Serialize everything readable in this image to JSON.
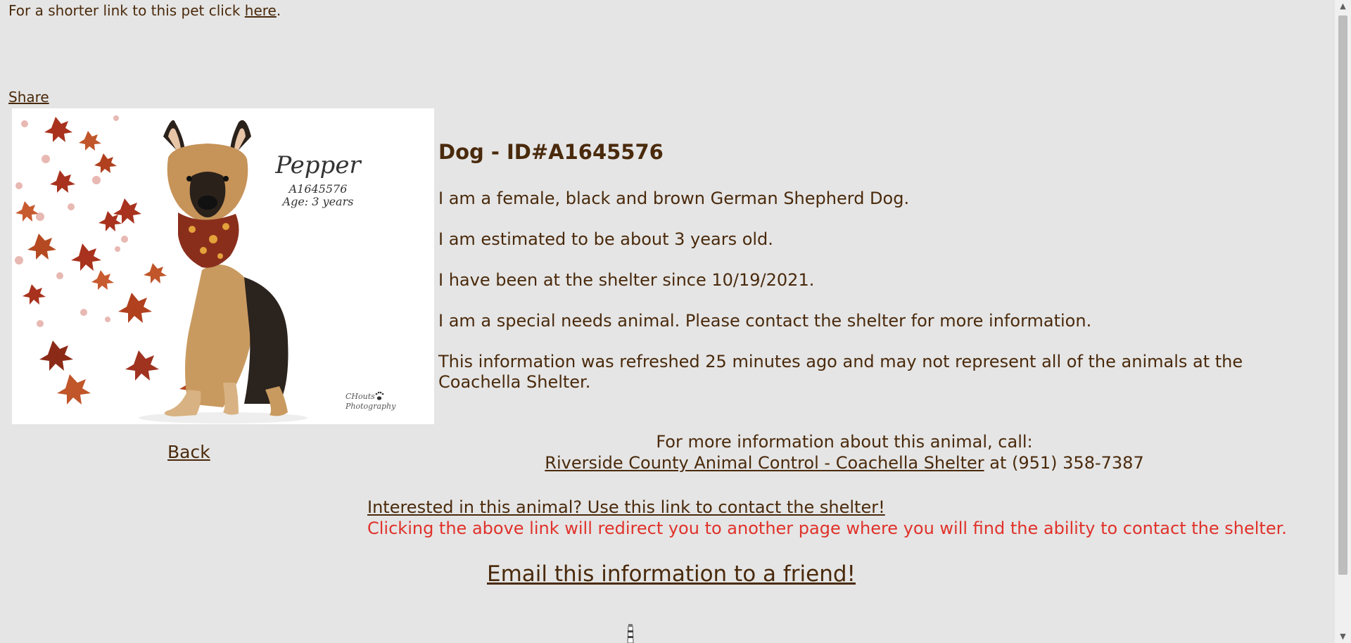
{
  "top": {
    "shorter_link_prefix": "For a shorter link to this pet click ",
    "shorter_link_text": "here",
    "shorter_link_suffix": "."
  },
  "share_label": "Share",
  "photo": {
    "name": "Pepper",
    "id": "A1645576",
    "age": "Age: 3 years",
    "credit_line1": "CHouts",
    "credit_line2": "Photography"
  },
  "back_label": "Back",
  "details": {
    "heading": "Dog - ID#A1645576",
    "line1": "I am a female, black and brown German Shepherd Dog.",
    "line2": "I am estimated to be about 3 years old.",
    "line3": "I have been at the shelter since 10/19/2021.",
    "line4": "I am a special needs animal. Please contact the shelter for more information.",
    "line5": "This information was refreshed 25 minutes ago and may not represent all of the animals at the Coachella Shelter."
  },
  "contact": {
    "call_text": "For more information about this animal, call:",
    "shelter_link": "Riverside County Animal Control - Coachella Shelter",
    "phone_prefix": " at ",
    "phone": "(951) 358-7387"
  },
  "interest": {
    "link": "Interested in this animal? Use this link to contact the shelter!",
    "note": "Clicking the above link will redirect you to another page where you will find the ability to contact the shelter."
  },
  "email_link": "Email this information to a friend!",
  "colors": {
    "background": "#e5e5e5",
    "text": "#4a2a0c",
    "warning": "#e0322a"
  }
}
